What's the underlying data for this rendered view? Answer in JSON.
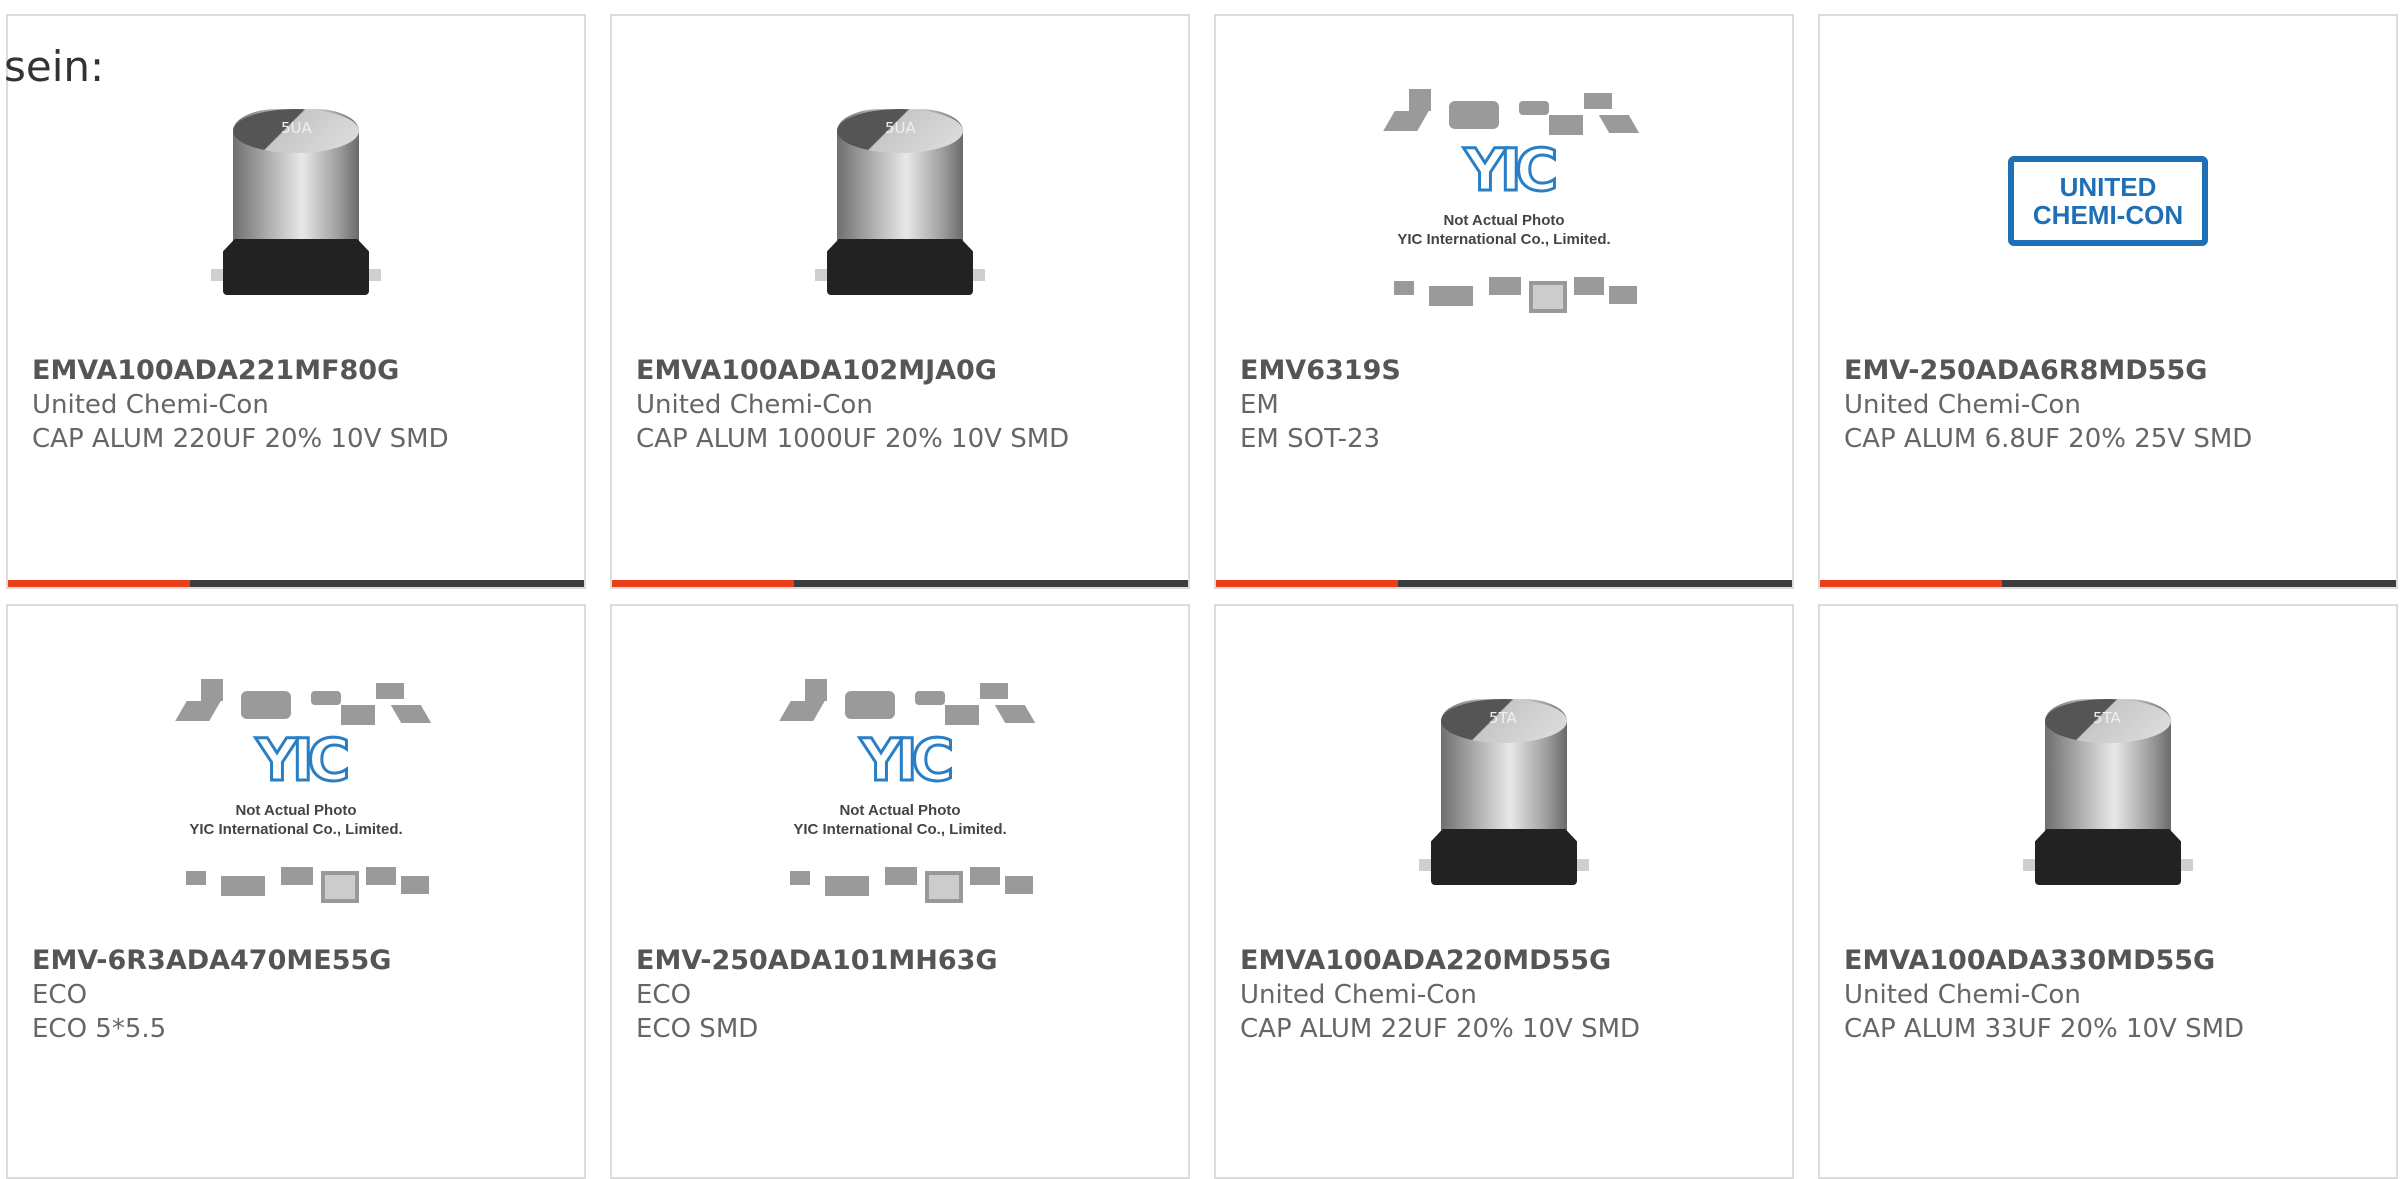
{
  "intro_text": "sein:",
  "colors": {
    "accent": "#e8401c",
    "bar": "#3c3c3c",
    "border": "#dcdcdc",
    "ucc_blue": "#1f6fb7"
  },
  "products": [
    {
      "part_number": "EMVA100ADA221MF80G",
      "manufacturer": "United Chemi-Con",
      "description": "CAP ALUM 220UF 20% 10V SMD",
      "image": "capacitor-image",
      "cap_mark": "5UA"
    },
    {
      "part_number": "EMVA100ADA102MJA0G",
      "manufacturer": "United Chemi-Con",
      "description": "CAP ALUM 1000UF 20% 10V SMD",
      "image": "capacitor-image",
      "cap_mark": "5UA"
    },
    {
      "part_number": "EMV6319S",
      "manufacturer": "EM",
      "description": "EM SOT-23",
      "image": "yic-placeholder-image",
      "yic_logo": "YIC",
      "yic_note_1": "Not Actual Photo",
      "yic_note_2": "YIC International Co., Limited."
    },
    {
      "part_number": "EMV-250ADA6R8MD55G",
      "manufacturer": "United Chemi-Con",
      "description": "CAP ALUM 6.8UF 20% 25V SMD",
      "image": "united-chemi-con-logo",
      "ucc_line_1": "UNITED",
      "ucc_line_2": "CHEMI-CON"
    },
    {
      "part_number": "EMV-6R3ADA470ME55G",
      "manufacturer": "ECO",
      "description": "ECO 5*5.5",
      "image": "yic-placeholder-image",
      "yic_logo": "YIC",
      "yic_note_1": "Not Actual Photo",
      "yic_note_2": "YIC International Co., Limited."
    },
    {
      "part_number": "EMV-250ADA101MH63G",
      "manufacturer": "ECO",
      "description": "ECO SMD",
      "image": "yic-placeholder-image",
      "yic_logo": "YIC",
      "yic_note_1": "Not Actual Photo",
      "yic_note_2": "YIC International Co., Limited."
    },
    {
      "part_number": "EMVA100ADA220MD55G",
      "manufacturer": "United Chemi-Con",
      "description": "CAP ALUM 22UF 20% 10V SMD",
      "image": "capacitor-image",
      "cap_mark": "5TA"
    },
    {
      "part_number": "EMVA100ADA330MD55G",
      "manufacturer": "United Chemi-Con",
      "description": "CAP ALUM 33UF 20% 10V SMD",
      "image": "capacitor-image",
      "cap_mark": "5TA"
    }
  ]
}
